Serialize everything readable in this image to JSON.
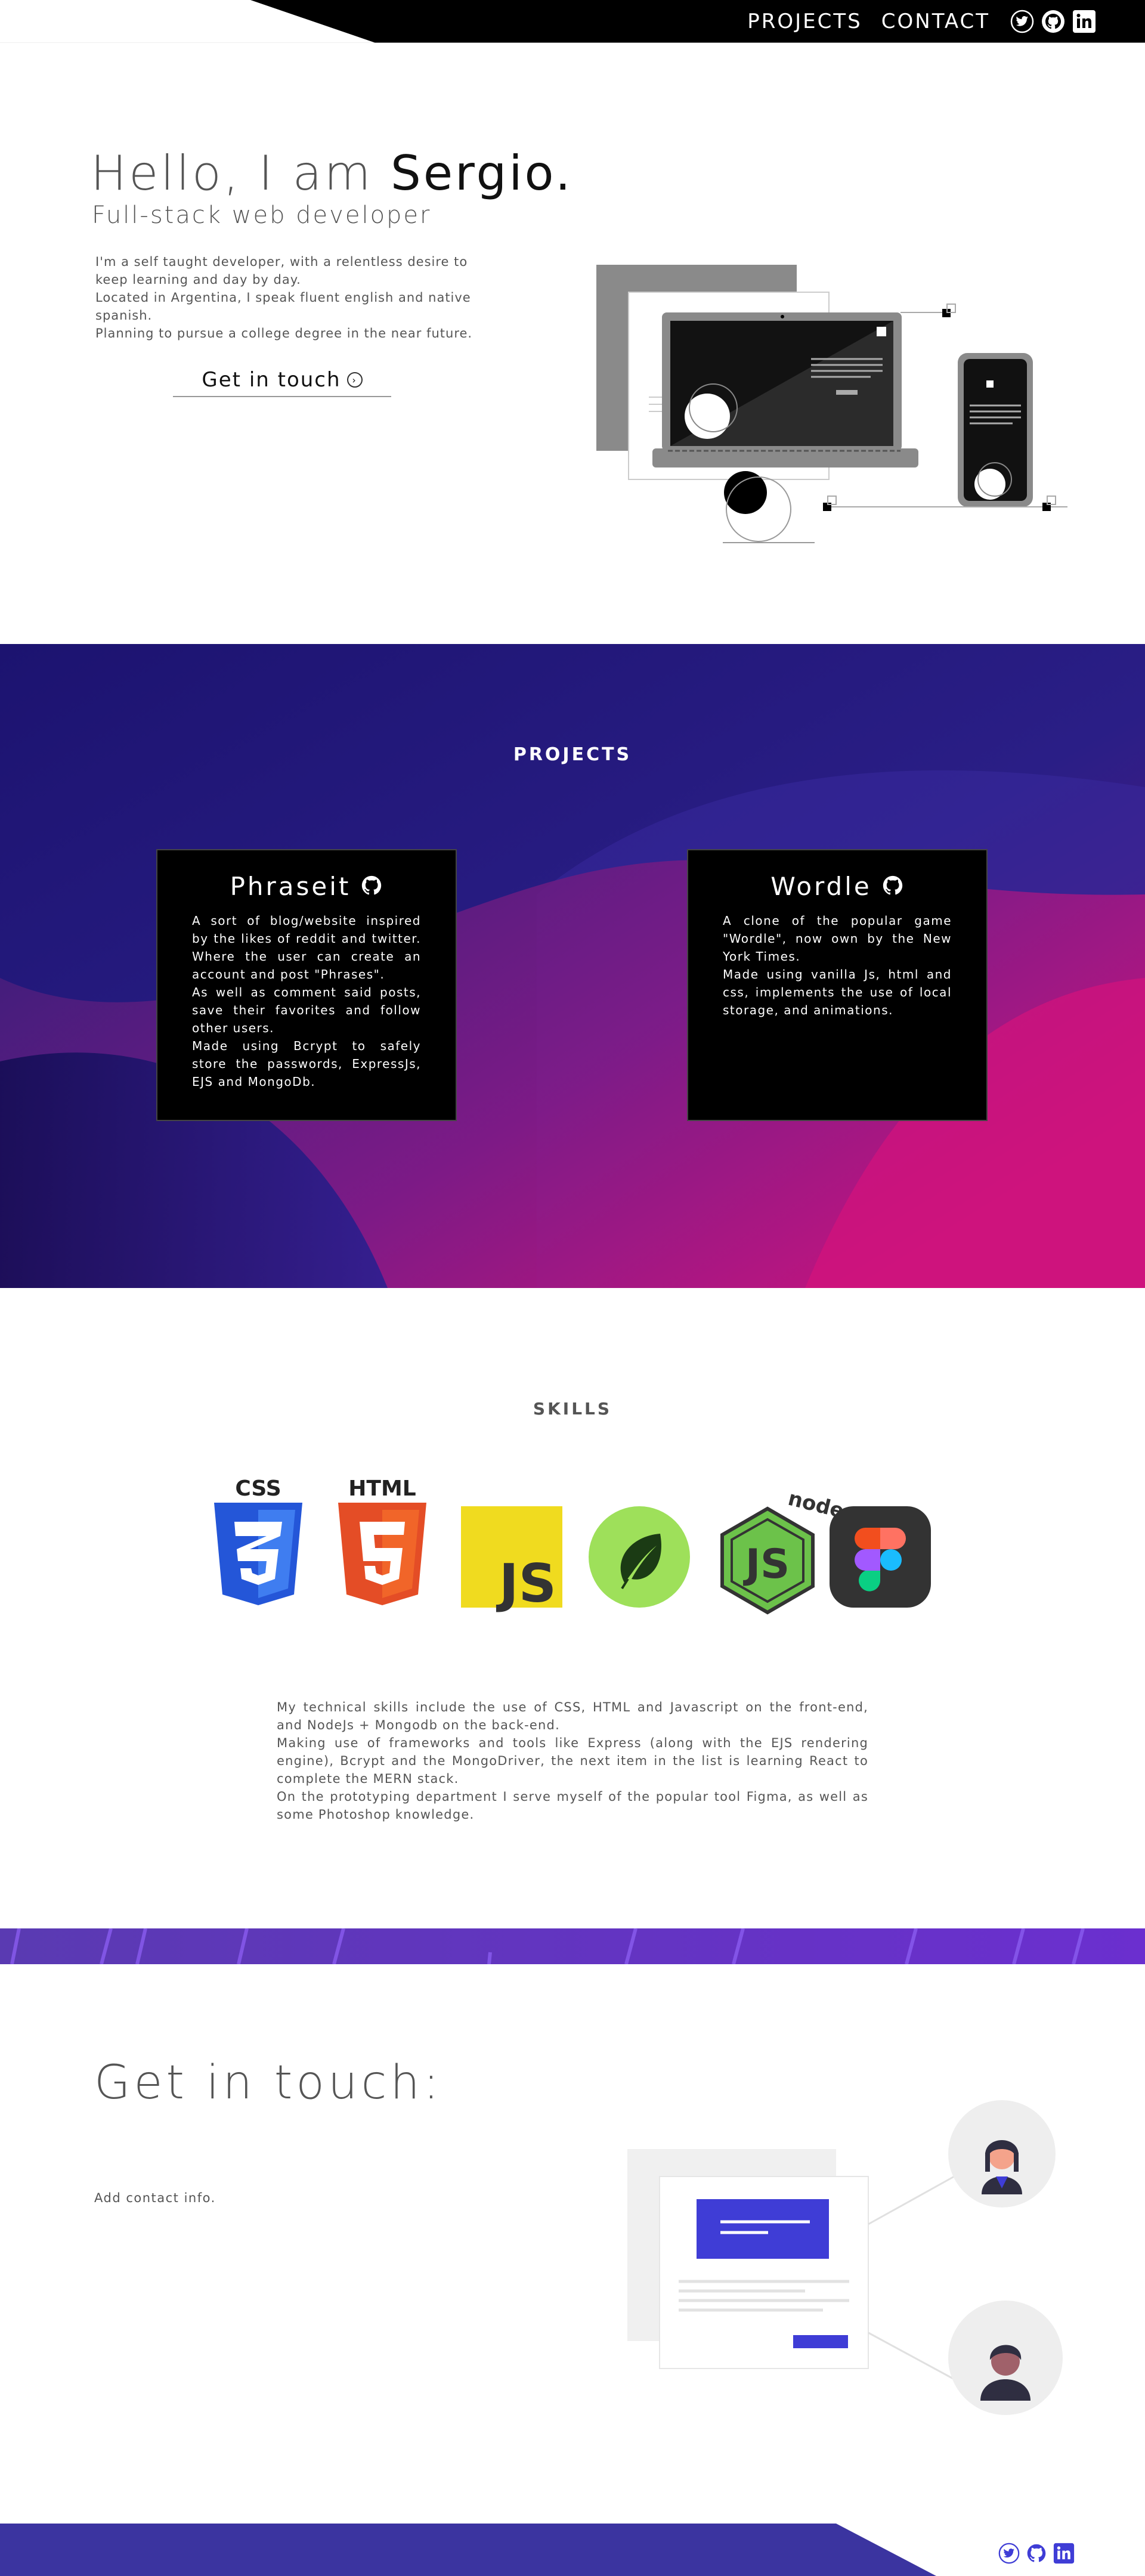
{
  "nav": {
    "links": [
      "PROJECTS",
      "CONTACT"
    ],
    "social_icons": [
      "twitter-icon",
      "github-icon",
      "linkedin-icon"
    ]
  },
  "hero": {
    "greeting": "Hello, I am",
    "name": "Sergio.",
    "subtitle": "Full-stack web developer",
    "description": "I'm a self taught developer, with a relentless desire to keep learning and  day by day.\nLocated in Argentina, I speak fluent english and native spanish.\nPlanning to pursue a college degree in the near future.",
    "cta_label": "Get in touch"
  },
  "projects": {
    "title": "PROJECTS",
    "cards": [
      {
        "title": "Phraseit",
        "description": "A sort of blog/website inspired by the likes of reddit and twitter. Where the user can create an account and post \"Phrases\".\nAs well as comment said posts, save their favorites and follow other users.\nMade using Bcrypt to safely store the passwords, ExpressJs, EJS and MongoDb."
      },
      {
        "title": "Wordle",
        "description": "A clone of the popular game \"Wordle\", now own by the New York Times.\nMade using vanilla Js, html and css, implements the use of local storage, and animations."
      }
    ]
  },
  "skills": {
    "title": "SKILLS",
    "icons": [
      {
        "name": "css3-icon",
        "label": "CSS"
      },
      {
        "name": "html5-icon",
        "label": "HTML"
      },
      {
        "name": "javascript-icon",
        "label": "JS"
      },
      {
        "name": "mongodb-icon",
        "label": ""
      },
      {
        "name": "nodejs-icon",
        "label": "node"
      },
      {
        "name": "figma-icon",
        "label": ""
      }
    ],
    "description": "My technical skills include the use of CSS, HTML and Javascript on the front-end, and NodeJs + Mongodb on the back-end.\nMaking use of frameworks and tools like Express (along with the EJS rendering engine), Bcrypt and the MongoDriver, the next item in the list is learning React to complete the MERN stack.\nOn the prototyping department I serve myself of the popular tool Figma, as well as some Photoshop knowledge."
  },
  "contact": {
    "title": "Get in touch:",
    "info": "Add contact info."
  },
  "colors": {
    "header_bg": "#000000",
    "projects_gradient_start": "#1c1370",
    "projects_gradient_end": "#d4127c",
    "stripe": "#6a35c9",
    "footer_bg": "#3b34a0",
    "accent_indigo": "#3f3dd6"
  }
}
